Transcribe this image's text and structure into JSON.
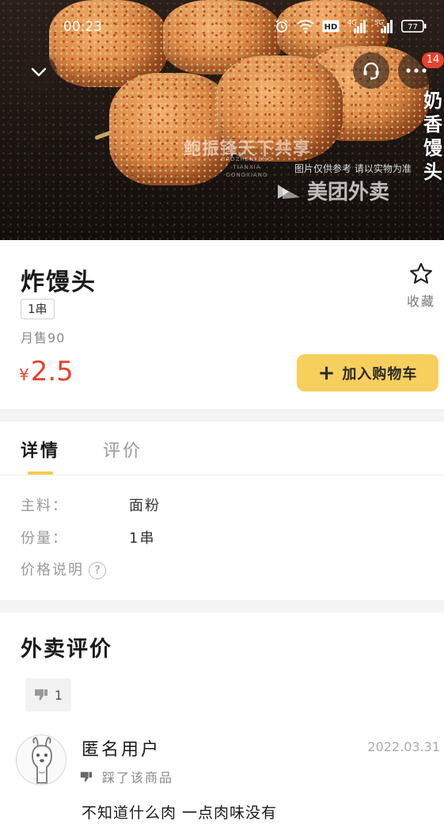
{
  "status_bar": {
    "time": "00:23",
    "network": "HD",
    "signal_1": "4G",
    "signal_2": "5G",
    "battery": "77"
  },
  "hero": {
    "watermark_brand": "鲍振锋天下共享",
    "watermark_brand_sub": "BAOZHENFENG TIANXIA GONGXIANG",
    "image_note": "图片仅供参考 请以实物为准",
    "platform_watermark": "美团外卖",
    "vertical_text": [
      "奶",
      "香",
      "馒",
      "头"
    ],
    "message_badge": "14"
  },
  "product": {
    "name": "炸馒头",
    "spec": "1串",
    "monthly_sales": "月售90",
    "currency": "¥",
    "price": "2.5",
    "favorite_label": "收藏",
    "add_to_cart_label": "加入购物车",
    "add_to_cart_icon": "+"
  },
  "tabs": [
    {
      "label": "详情",
      "active": true
    },
    {
      "label": "评价",
      "active": false
    }
  ],
  "details": {
    "rows": [
      {
        "label": "主料：",
        "value": "面粉"
      },
      {
        "label": "份量：",
        "value": "1串"
      }
    ],
    "price_note_label": "价格说明",
    "price_note_icon": "?"
  },
  "reviews": {
    "title": "外卖评价",
    "filter_count": "1",
    "items": [
      {
        "user": "匿名用户",
        "date": "2022.03.31",
        "tag": "踩了该商品",
        "text": "不知道什么肉 一点肉味没有"
      }
    ]
  },
  "colors": {
    "accent_yellow": "#f7cf5c",
    "price_red": "#e8412c",
    "badge_red": "#e8412c"
  }
}
